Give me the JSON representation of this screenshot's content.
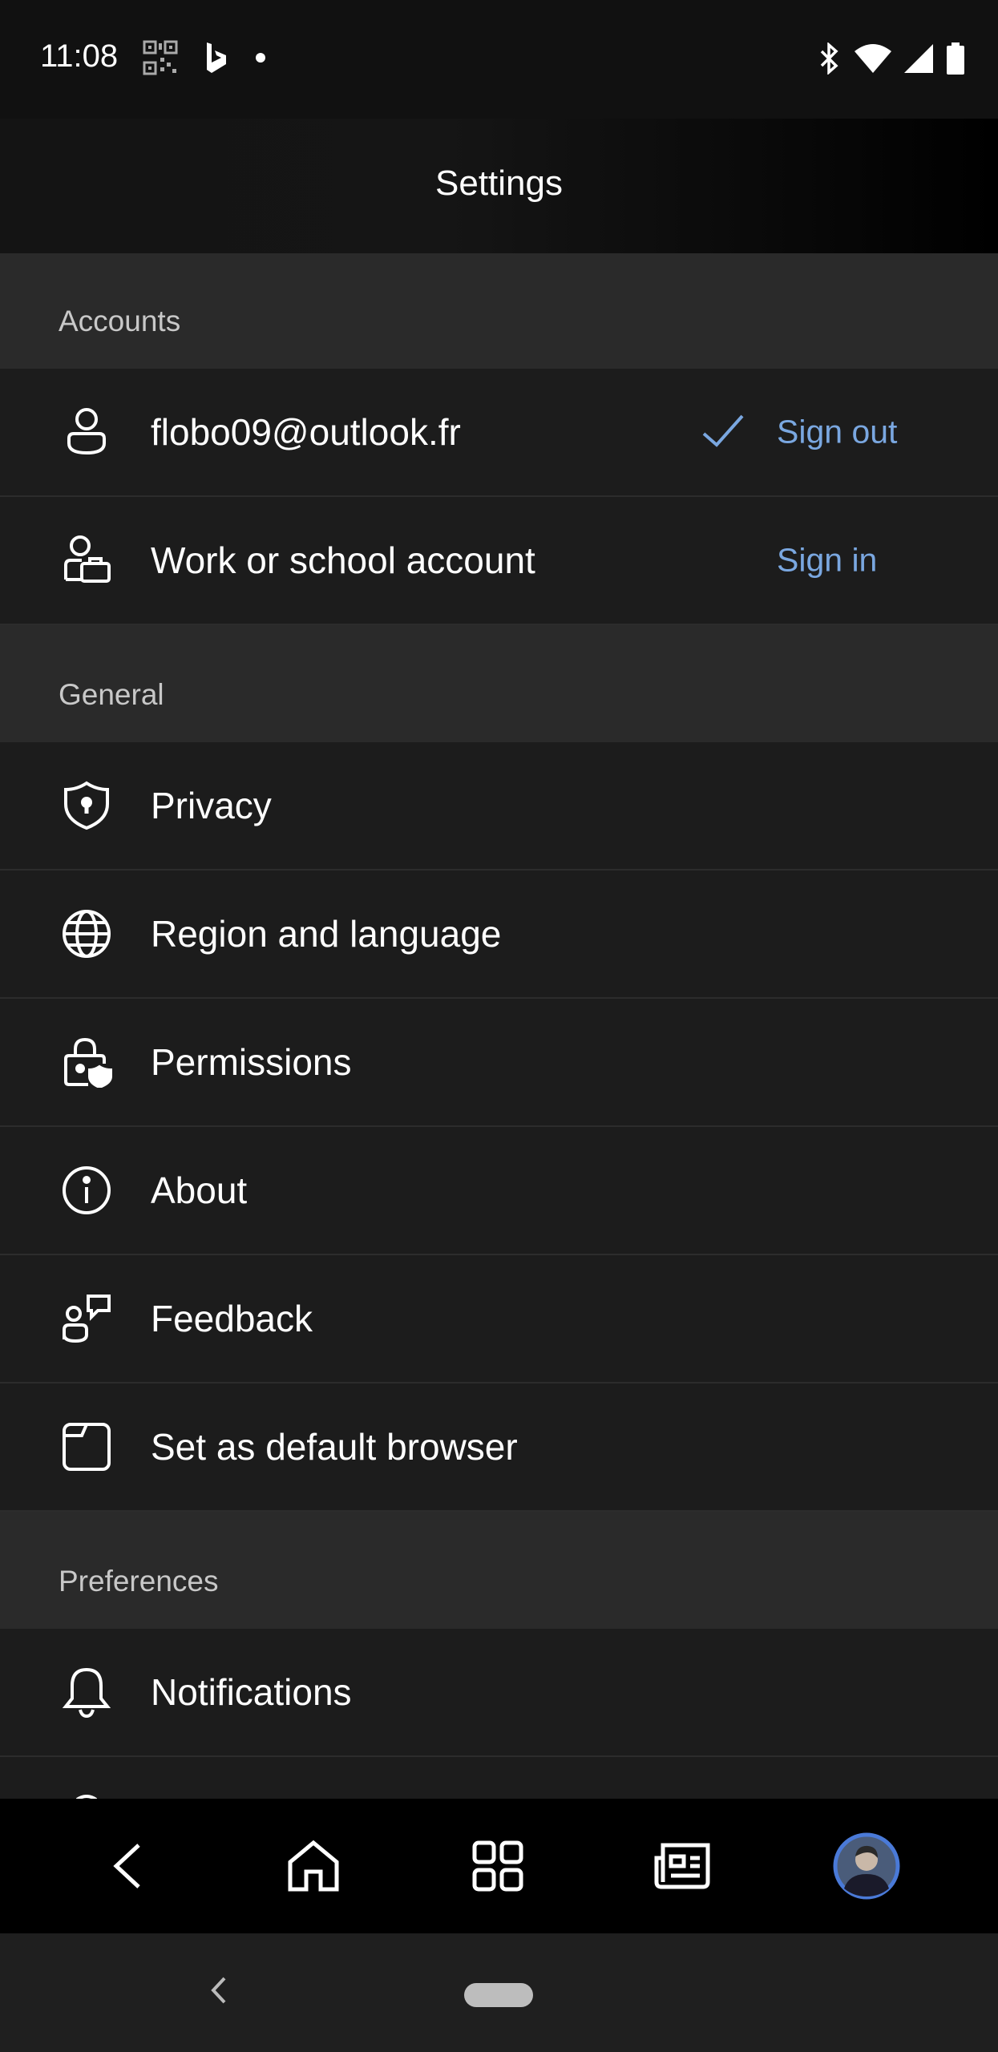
{
  "status_bar": {
    "time": "11:08",
    "left_icons": [
      "qr-code-icon",
      "bing-icon",
      "dot-icon"
    ],
    "right_icons": [
      "bluetooth-icon",
      "wifi-icon",
      "signal-icon",
      "battery-icon"
    ]
  },
  "header": {
    "title": "Settings"
  },
  "sections": {
    "accounts": {
      "title": "Accounts",
      "items": [
        {
          "label": "flobo09@outlook.fr",
          "icon": "person-icon",
          "action": "Sign out",
          "checked": true
        },
        {
          "label": "Work or school account",
          "icon": "work-account-icon",
          "action": "Sign in"
        }
      ]
    },
    "general": {
      "title": "General",
      "items": [
        {
          "label": "Privacy",
          "icon": "shield-icon"
        },
        {
          "label": "Region and language",
          "icon": "globe-icon"
        },
        {
          "label": "Permissions",
          "icon": "lock-shield-icon"
        },
        {
          "label": "About",
          "icon": "info-icon"
        },
        {
          "label": "Feedback",
          "icon": "feedback-icon"
        },
        {
          "label": "Set as default browser",
          "icon": "browser-window-icon"
        }
      ]
    },
    "preferences": {
      "title": "Preferences",
      "items": [
        {
          "label": "Notifications",
          "icon": "bell-icon"
        }
      ]
    }
  },
  "bottom_toolbar": {
    "buttons": [
      "back-icon",
      "home-icon",
      "apps-grid-icon",
      "news-icon",
      "profile-avatar"
    ]
  },
  "colors": {
    "accent": "#7aa7e0",
    "background": "#1c1c1c",
    "section_header": "#2a2a2a",
    "text": "#ffffff"
  }
}
